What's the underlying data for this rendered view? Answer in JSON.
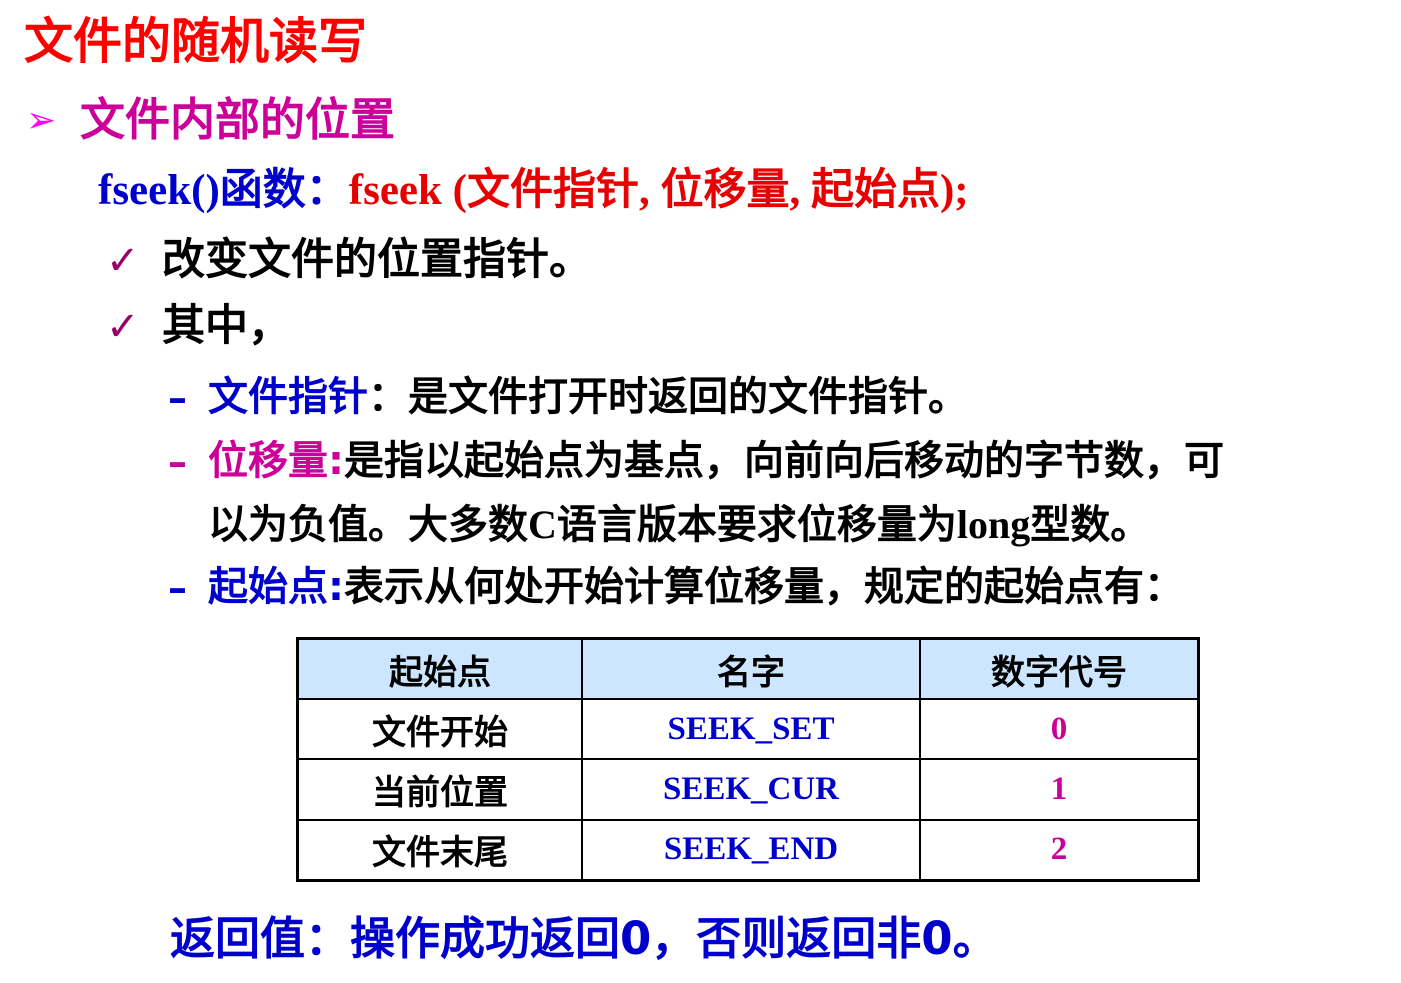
{
  "title": "文件的随机读写",
  "section": {
    "bullet": "➢",
    "heading": "文件内部的位置"
  },
  "fseek": {
    "name": "fseek()函数：",
    "signature": "fseek (文件指针, 位移量, 起始点);"
  },
  "check_mark": "✓",
  "bullets": [
    "改变文件的位置指针。",
    "其中，"
  ],
  "dash": "–",
  "params": {
    "file_pointer": {
      "term": "文件指针",
      "desc": "：是文件打开时返回的文件指针。"
    },
    "offset": {
      "term": "位移量:",
      "desc_line1": "是指以起始点为基点，向前向后移动的字节数，可",
      "desc_line2_a": "以为负值。大多数",
      "desc_line2_c": "C",
      "desc_line2_b": "语言版本要求位移量为",
      "desc_line2_long": "long",
      "desc_line2_d": "型数。"
    },
    "origin": {
      "term": "起始点:",
      "desc": "表示从何处开始计算位移量，规定的起始点有："
    }
  },
  "table": {
    "headers": [
      "起始点",
      "名字",
      "数字代号"
    ],
    "rows": [
      {
        "origin": "文件开始",
        "name": "SEEK_SET",
        "code": "0"
      },
      {
        "origin": "当前位置",
        "name": "SEEK_CUR",
        "code": "1"
      },
      {
        "origin": "文件末尾",
        "name": "SEEK_END",
        "code": "2"
      }
    ]
  },
  "return_value": "返回值：操作成功返回0，否则返回非0。",
  "colors": {
    "title": "#ff0000",
    "heading": "#cc0099",
    "blue": "#0000cc",
    "signature": "#e60000",
    "table_header_bg": "#cce6ff"
  }
}
